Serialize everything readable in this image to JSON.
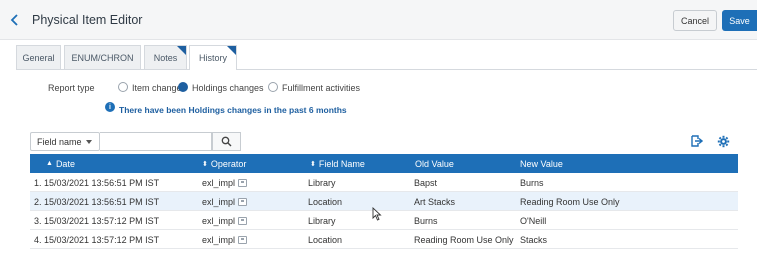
{
  "header": {
    "title": "Physical Item Editor",
    "cancel_label": "Cancel",
    "save_label": "Save"
  },
  "tabs": [
    {
      "label": "General",
      "active": false,
      "has_corner": false
    },
    {
      "label": "ENUM/CHRON",
      "active": false,
      "has_corner": false
    },
    {
      "label": "Notes",
      "active": false,
      "has_corner": true
    },
    {
      "label": "History",
      "active": true,
      "has_corner": true
    }
  ],
  "report": {
    "label": "Report type",
    "options": [
      {
        "label": "Item changes",
        "selected": false
      },
      {
        "label": "Holdings changes",
        "selected": true
      },
      {
        "label": "Fulfillment activities",
        "selected": false
      }
    ],
    "info": "There have been Holdings changes in the past 6 months"
  },
  "filter": {
    "field_label": "Field name",
    "search_value": "",
    "search_placeholder": ""
  },
  "table": {
    "columns": [
      {
        "label": "Date",
        "sort": "▲"
      },
      {
        "label": "Operator",
        "sort": "⬍"
      },
      {
        "label": "Field Name",
        "sort": "⬍"
      },
      {
        "label": "Old Value",
        "sort": ""
      },
      {
        "label": "New Value",
        "sort": ""
      }
    ],
    "rows": [
      {
        "date": "1. 15/03/2021 13:56:51 PM IST",
        "operator": "exl_impl",
        "field": "Library",
        "old": "Bapst",
        "new": "Burns"
      },
      {
        "date": "2. 15/03/2021 13:56:51 PM IST",
        "operator": "exl_impl",
        "field": "Location",
        "old": "Art Stacks",
        "new": "Reading Room Use Only"
      },
      {
        "date": "3. 15/03/2021 13:57:12 PM IST",
        "operator": "exl_impl",
        "field": "Library",
        "old": "Burns",
        "new": "O'Neill"
      },
      {
        "date": "4. 15/03/2021 13:57:12 PM IST",
        "operator": "exl_impl",
        "field": "Location",
        "old": "Reading Room Use Only",
        "new": "Stacks"
      }
    ]
  },
  "colors": {
    "accent": "#1e6fb7",
    "row_highlight": "#e9f2fb"
  },
  "icons": [
    "chevron-left-icon",
    "search-icon",
    "export-icon",
    "gear-icon",
    "operator-card-icon",
    "info-icon",
    "mouse-cursor-icon"
  ]
}
